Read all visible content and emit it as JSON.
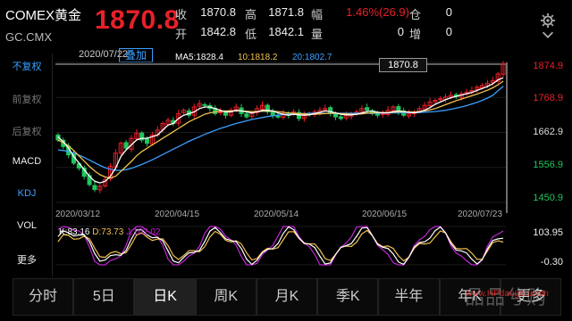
{
  "header": {
    "name": "COMEX黄金",
    "code": "GC.CMX",
    "price": "1870.8",
    "quotes": [
      {
        "label": "收",
        "value": "1870.8",
        "red": false
      },
      {
        "label": "高",
        "value": "1871.8",
        "red": false
      },
      {
        "label": "幅",
        "value": "1.46%(26.9)",
        "red": true
      },
      {
        "label": "仓",
        "value": "0",
        "red": false
      },
      {
        "label": "开",
        "value": "1842.8",
        "red": false
      },
      {
        "label": "低",
        "value": "1842.1",
        "red": false
      },
      {
        "label": "量",
        "value": "0",
        "red": false
      },
      {
        "label": "增",
        "value": "0",
        "red": false
      }
    ]
  },
  "sidebar": {
    "items": [
      {
        "label": "不复权",
        "state": "active"
      },
      {
        "label": "前复权",
        "state": "dim"
      },
      {
        "label": "后复权",
        "state": "dim"
      },
      {
        "label": "MACD",
        "state": "on"
      },
      {
        "label": "KDJ",
        "state": "active"
      },
      {
        "label": "VOL",
        "state": "on"
      },
      {
        "label": "更多",
        "state": "on"
      }
    ]
  },
  "chart": {
    "date_tag": "2020/07/22",
    "overlay_label": "叠加",
    "ma": [
      {
        "label": "MA5:1828.4",
        "color": "#ffffff"
      },
      {
        "label": "10:1818.2",
        "color": "#f2c14e"
      },
      {
        "label": "20:1802.7",
        "color": "#3aa0ff"
      }
    ],
    "current_price_flag": "1870.8",
    "y_labels": [
      {
        "value": "1874.9",
        "color": "#e8202a"
      },
      {
        "value": "1768.9",
        "color": "#e8202a"
      },
      {
        "value": "1662.9",
        "color": "#dddddd"
      },
      {
        "value": "1556.9",
        "color": "#22c55e"
      },
      {
        "value": "1450.9",
        "color": "#22c55e"
      }
    ],
    "x_labels": [
      "2020/03/12",
      "2020/04/15",
      "2020/05/14",
      "2020/06/15",
      "2020/07/23"
    ],
    "kdj": {
      "k": "K:83.16",
      "d": "D:73.73",
      "j": "J:102.02",
      "k_color": "#ffffff",
      "d_color": "#f2c14e",
      "j_color": "#c026d3"
    },
    "kdj_y_top": "103.95",
    "kdj_y_bottom": "-0.30"
  },
  "tabs": [
    {
      "label": "分时",
      "selected": false
    },
    {
      "label": "5日",
      "selected": false
    },
    {
      "label": "日K",
      "selected": true
    },
    {
      "label": "周K",
      "selected": false
    },
    {
      "label": "月K",
      "selected": false
    },
    {
      "label": "季K",
      "selected": false
    },
    {
      "label": "半年",
      "selected": false
    },
    {
      "label": "年K",
      "selected": false
    },
    {
      "label": "更多",
      "selected": false
    }
  ],
  "watermark": {
    "text": "品品兮购",
    "url": "www.HPdaogou.com"
  },
  "chart_data": {
    "type": "candlestick",
    "ylim": [
      1450.9,
      1874.9
    ],
    "closes": [
      1640,
      1620,
      1595,
      1570,
      1555,
      1530,
      1505,
      1490,
      1500,
      1520,
      1560,
      1600,
      1630,
      1615,
      1645,
      1660,
      1640,
      1630,
      1655,
      1670,
      1690,
      1700,
      1690,
      1720,
      1730,
      1715,
      1740,
      1750,
      1745,
      1735,
      1720,
      1725,
      1715,
      1730,
      1740,
      1720,
      1710,
      1720,
      1735,
      1745,
      1725,
      1715,
      1710,
      1720,
      1715,
      1725,
      1705,
      1715,
      1720,
      1725,
      1730,
      1735,
      1720,
      1710,
      1705,
      1715,
      1720,
      1725,
      1735,
      1730,
      1720,
      1715,
      1720,
      1730,
      1740,
      1725,
      1715,
      1720,
      1725,
      1735,
      1745,
      1755,
      1760,
      1765,
      1770,
      1775,
      1772,
      1780,
      1785,
      1790,
      1800,
      1805,
      1812,
      1820,
      1840,
      1870.8
    ],
    "ma5": [
      1650,
      1635,
      1615,
      1590,
      1570,
      1550,
      1530,
      1515,
      1510,
      1515,
      1530,
      1555,
      1590,
      1610,
      1625,
      1640,
      1645,
      1645,
      1650,
      1655,
      1670,
      1685,
      1690,
      1705,
      1715,
      1720,
      1725,
      1735,
      1740,
      1740,
      1735,
      1730,
      1725,
      1725,
      1730,
      1728,
      1725,
      1722,
      1725,
      1730,
      1730,
      1728,
      1722,
      1718,
      1715,
      1718,
      1716,
      1715,
      1716,
      1720,
      1724,
      1728,
      1726,
      1722,
      1718,
      1716,
      1716,
      1718,
      1722,
      1726,
      1728,
      1724,
      1722,
      1722,
      1726,
      1728,
      1726,
      1724,
      1722,
      1725,
      1730,
      1738,
      1748,
      1755,
      1762,
      1768,
      1772,
      1776,
      1780,
      1784,
      1790,
      1796,
      1802,
      1810,
      1822,
      1828.4
    ],
    "ma10": [
      1640,
      1632,
      1622,
      1608,
      1592,
      1576,
      1560,
      1546,
      1535,
      1528,
      1525,
      1530,
      1545,
      1560,
      1575,
      1592,
      1605,
      1615,
      1625,
      1635,
      1645,
      1655,
      1665,
      1675,
      1685,
      1695,
      1703,
      1710,
      1718,
      1722,
      1725,
      1727,
      1728,
      1728,
      1728,
      1728,
      1727,
      1726,
      1726,
      1727,
      1728,
      1727,
      1726,
      1724,
      1722,
      1721,
      1720,
      1719,
      1718,
      1718,
      1719,
      1720,
      1721,
      1721,
      1720,
      1719,
      1718,
      1718,
      1719,
      1721,
      1722,
      1723,
      1723,
      1723,
      1724,
      1725,
      1725,
      1725,
      1725,
      1726,
      1728,
      1731,
      1735,
      1741,
      1747,
      1753,
      1759,
      1764,
      1769,
      1774,
      1779,
      1785,
      1791,
      1798,
      1807,
      1818.2
    ],
    "ma20": [
      1610,
      1608,
      1605,
      1600,
      1594,
      1587,
      1579,
      1571,
      1563,
      1556,
      1551,
      1548,
      1548,
      1550,
      1554,
      1560,
      1566,
      1573,
      1580,
      1588,
      1596,
      1604,
      1612,
      1620,
      1628,
      1636,
      1643,
      1650,
      1657,
      1663,
      1669,
      1675,
      1680,
      1685,
      1690,
      1694,
      1698,
      1702,
      1705,
      1708,
      1711,
      1713,
      1715,
      1717,
      1718,
      1719,
      1720,
      1720,
      1721,
      1721,
      1721,
      1721,
      1721,
      1721,
      1721,
      1721,
      1721,
      1721,
      1721,
      1721,
      1721,
      1721,
      1722,
      1722,
      1722,
      1722,
      1723,
      1723,
      1723,
      1723,
      1724,
      1725,
      1726,
      1728,
      1730,
      1733,
      1736,
      1740,
      1744,
      1749,
      1754,
      1760,
      1767,
      1775,
      1789,
      1802.7
    ]
  }
}
